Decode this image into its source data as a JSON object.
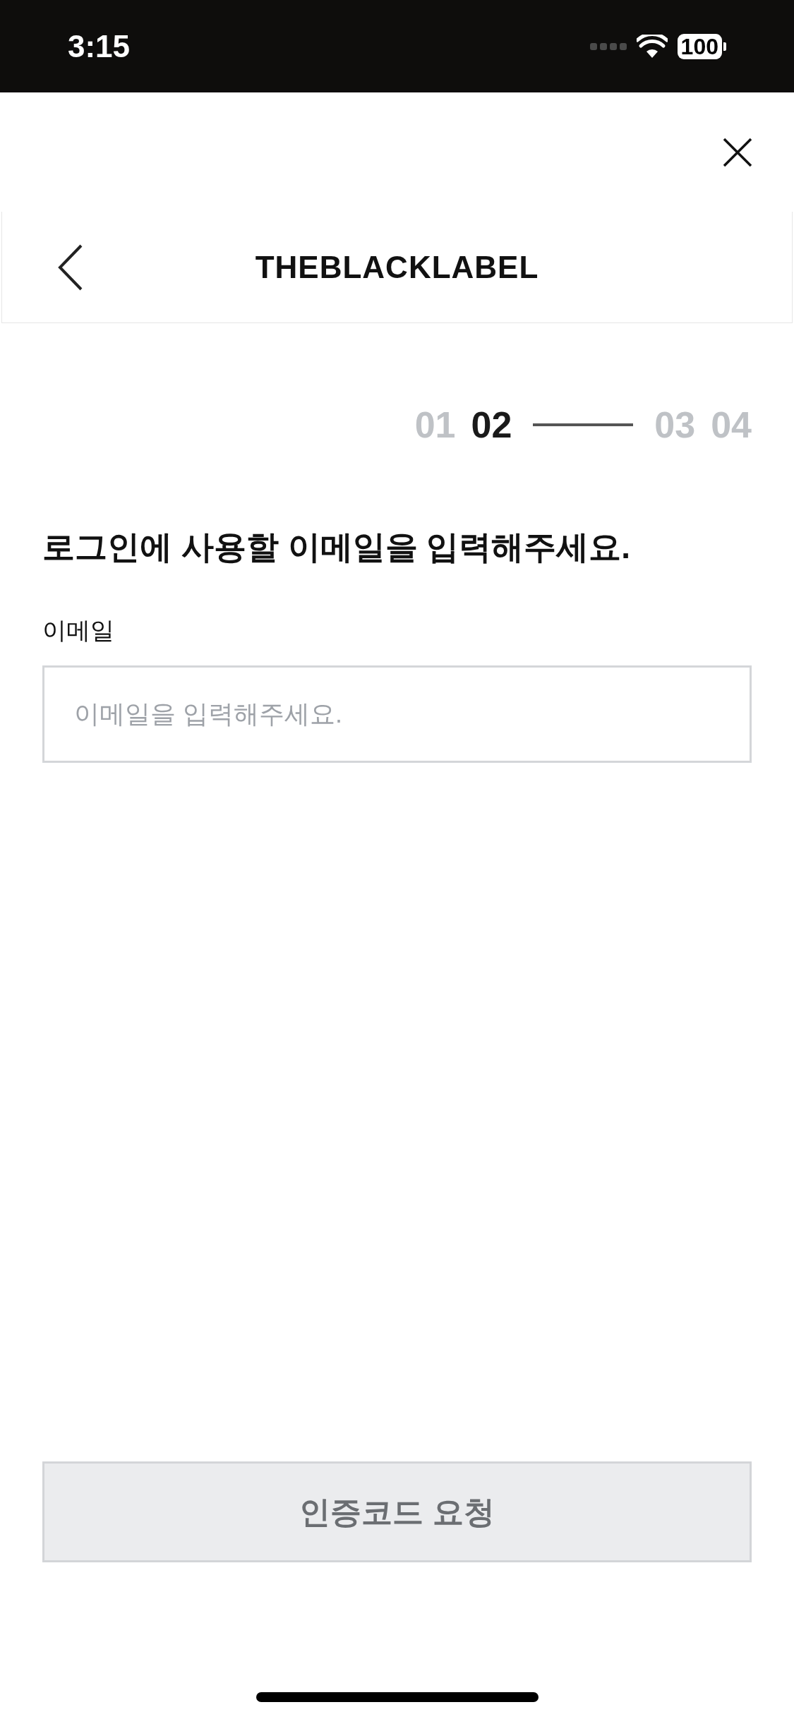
{
  "status_bar": {
    "time": "3:15",
    "battery": "100"
  },
  "header": {
    "logo": "THEBLACKLABEL"
  },
  "steps": [
    {
      "label": "01",
      "selected": false
    },
    {
      "label": "02",
      "selected": true
    },
    {
      "label": "03",
      "selected": false
    },
    {
      "label": "04",
      "selected": false
    }
  ],
  "title": "로그인에 사용할 이메일을 입력해주세요.",
  "email_field": {
    "label": "이메일",
    "placeholder": "이메일을 입력해주세요."
  },
  "submit_button": {
    "label": "인증코드 요청",
    "disabled": true
  }
}
